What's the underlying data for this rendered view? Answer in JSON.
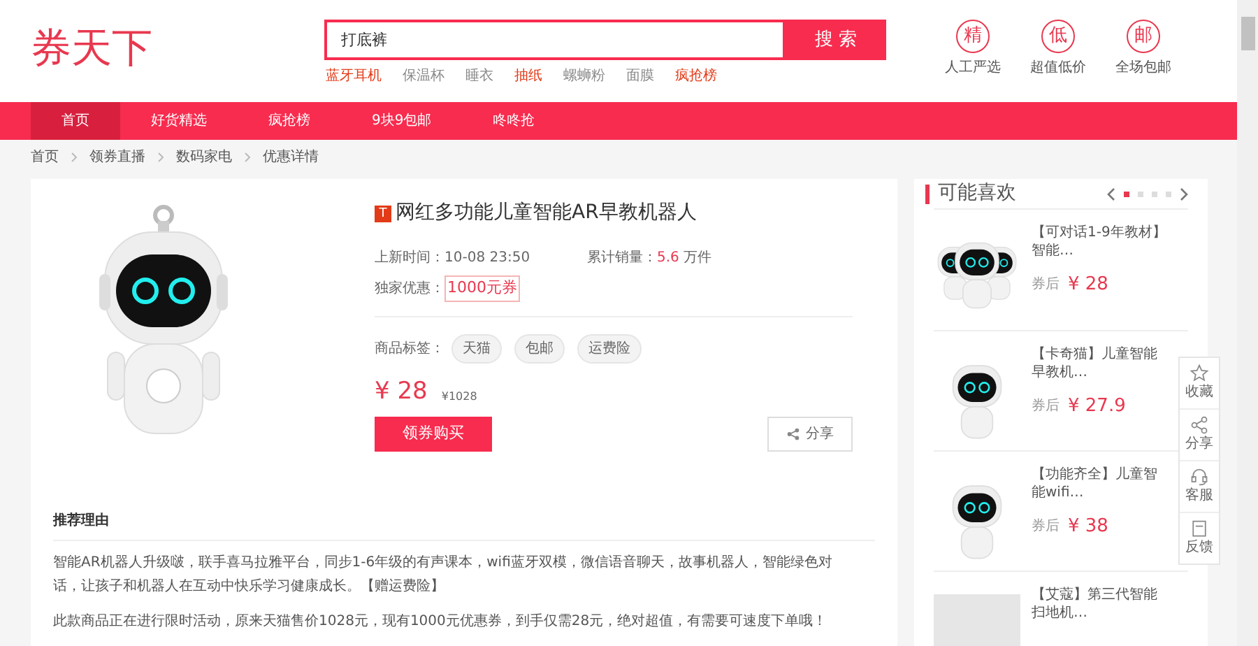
{
  "logo": "券天下",
  "search": {
    "value": "打底裤",
    "button": "搜 索"
  },
  "hot_keywords": [
    {
      "label": "蓝牙耳机",
      "hot": true
    },
    {
      "label": "保温杯",
      "hot": false
    },
    {
      "label": "睡衣",
      "hot": false
    },
    {
      "label": "抽纸",
      "hot": true
    },
    {
      "label": "螺蛳粉",
      "hot": false
    },
    {
      "label": "面膜",
      "hot": false
    },
    {
      "label": "疯抢榜",
      "hot": true
    }
  ],
  "features": [
    {
      "badge": "精",
      "label": "人工严选"
    },
    {
      "badge": "低",
      "label": "超值低价"
    },
    {
      "badge": "邮",
      "label": "全场包邮"
    }
  ],
  "nav": [
    {
      "label": "首页",
      "selected": true
    },
    {
      "label": "好货精选",
      "selected": false
    },
    {
      "label": "疯抢榜",
      "selected": false
    },
    {
      "label": "9块9包邮",
      "selected": false
    },
    {
      "label": "咚咚抢",
      "selected": false
    }
  ],
  "breadcrumb": [
    "首页",
    "领券直播",
    "数码家电",
    "优惠详情"
  ],
  "product": {
    "platform_badge": "T",
    "title": "网红多功能儿童智能AR早教机器人",
    "listed_label": "上新时间：",
    "listed": "10-08 23:50",
    "sales_label": "累计销量：",
    "sales": "5.6",
    "sales_unit": "万件",
    "coupon_label": "独家优惠：",
    "coupon": "1000元券",
    "tags_label": "商品标签：",
    "tags": [
      "天猫",
      "包邮",
      "运费险"
    ],
    "price": "¥ 28",
    "original_price": "¥1028",
    "buy_button": "领券购买",
    "share_button": "分享"
  },
  "reason": {
    "heading": "推荐理由",
    "paragraphs": [
      "智能AR机器人升级啵，联手喜马拉雅平台，同步1-6年级的有声课本，wifi蓝牙双模，微信语音聊天，故事机器人，智能绿色对话，让孩子和机器人在互动中快乐学习健康成长。【赠运费险】",
      "此款商品正在进行限时活动，原来天猫售价1028元，现有1000元优惠券，到手仅需28元，绝对超值，有需要可速度下单哦！"
    ]
  },
  "recommend": {
    "title": "可能喜欢",
    "pages": [
      {
        "selected": true
      },
      {
        "selected": false
      },
      {
        "selected": false
      },
      {
        "selected": false
      }
    ],
    "items": [
      {
        "kind": "robots",
        "title": "【可对话1-9年教材】智能…",
        "price_label": "券后",
        "price": "¥ 28"
      },
      {
        "kind": "robot",
        "title": "【卡奇猫】儿童智能早教机…",
        "price_label": "券后",
        "price": "¥ 27.9"
      },
      {
        "kind": "robot",
        "title": "【功能齐全】儿童智能wifi…",
        "price_label": "券后",
        "price": "¥ 38"
      },
      {
        "kind": "photo",
        "title": "【艾蔻】第三代智能扫地机…"
      }
    ]
  },
  "side_tools": [
    {
      "kind": "star",
      "label": "收藏"
    },
    {
      "kind": "share",
      "label": "分享"
    },
    {
      "kind": "headset",
      "label": "客服"
    },
    {
      "kind": "feedback",
      "label": "反馈"
    }
  ]
}
